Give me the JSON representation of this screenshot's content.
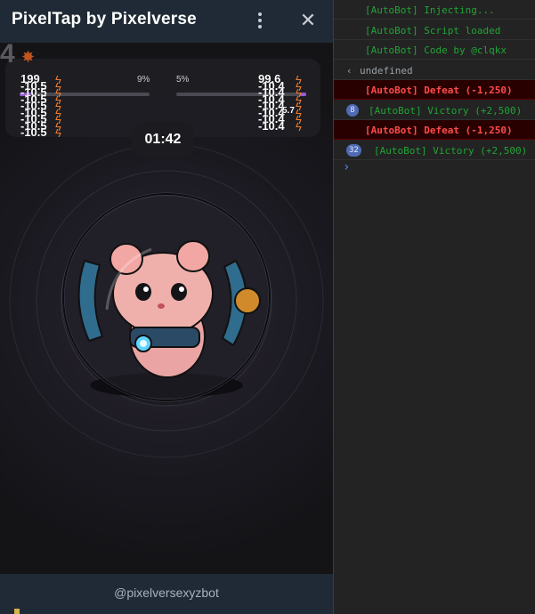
{
  "app": {
    "title": "PixelTap by Pixelverse",
    "close_glyph": "✕",
    "footer_text": "@pixelversexyzbot"
  },
  "game": {
    "big_number": "4",
    "left_pct": "9%",
    "right_pct": "5%",
    "left_bar_fill": 0.09,
    "right_bar_fill": 0.05,
    "timer": "01:42",
    "left_stack": [
      "199",
      "-10.5",
      "-10.5",
      "-10.5",
      "-10.5",
      "-10.5",
      "-10.5",
      "-10.5",
      "-10.5"
    ],
    "right_stack": [
      "99.6",
      "-10.4",
      "-10.4",
      "-10.4",
      "-10.4",
      "-10.4",
      "-10.4",
      "-10.4"
    ],
    "right_extra": "5.7",
    "colors": {
      "accent": "#9a5bd8",
      "bolt": "#f07a2a"
    }
  },
  "console": {
    "lines": [
      {
        "type": "log",
        "text": "[AutoBot] Injecting..."
      },
      {
        "type": "log",
        "text": "[AutoBot] Script loaded"
      },
      {
        "type": "log",
        "text": "[AutoBot] Code by @clqkx"
      },
      {
        "type": "return",
        "text": "undefined"
      },
      {
        "type": "error",
        "text": "[AutoBot] Defeat (-1,250)"
      },
      {
        "type": "log",
        "count": "8",
        "text": "[AutoBot] Victory (+2,500)"
      },
      {
        "type": "error",
        "text": "[AutoBot] Defeat (-1,250)"
      },
      {
        "type": "log",
        "count": "32",
        "text": "[AutoBot] Victory (+2,500)"
      }
    ],
    "prompt_glyph": "›",
    "return_glyph": "‹"
  }
}
